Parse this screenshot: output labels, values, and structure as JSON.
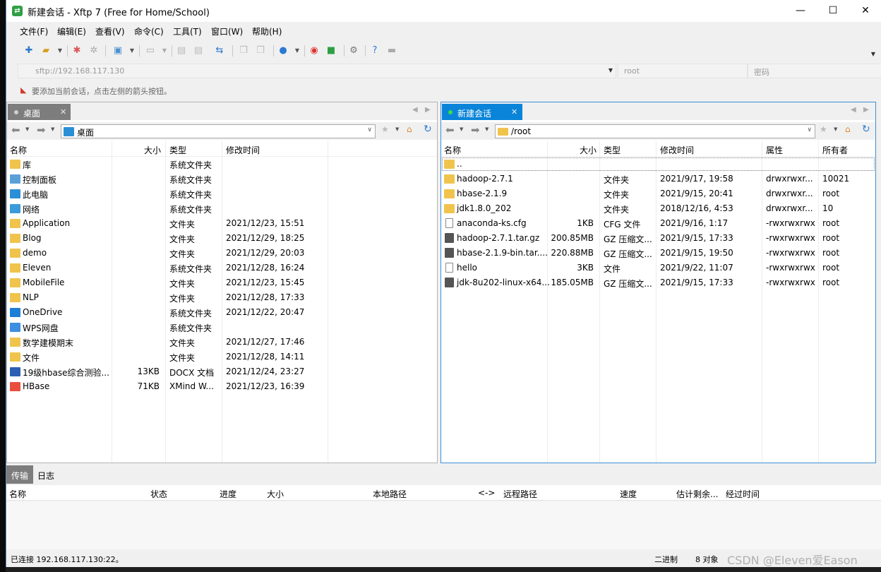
{
  "window": {
    "title": "新建会话 - Xftp 7 (Free for Home/School)",
    "minimize": "—",
    "maximize": "☐",
    "close": "✕"
  },
  "menu": [
    "文件(F)",
    "编辑(E)",
    "查看(V)",
    "命令(C)",
    "工具(T)",
    "窗口(W)",
    "帮助(H)"
  ],
  "address": {
    "url_placeholder": "sftp://192.168.117.130",
    "user_placeholder": "root",
    "password_placeholder": "密码"
  },
  "hint": "要添加当前会话，点击左侧的箭头按钮。",
  "left": {
    "tab": "桌面",
    "path": "桌面",
    "columns": [
      "名称",
      "大小",
      "类型",
      "修改时间"
    ],
    "rows": [
      {
        "name": "库",
        "size": "",
        "type": "系统文件夹",
        "mtime": "",
        "icon": "folder"
      },
      {
        "name": "控制面板",
        "size": "",
        "type": "系统文件夹",
        "mtime": "",
        "icon": "control-panel"
      },
      {
        "name": "此电脑",
        "size": "",
        "type": "系统文件夹",
        "mtime": "",
        "icon": "computer"
      },
      {
        "name": "网络",
        "size": "",
        "type": "系统文件夹",
        "mtime": "",
        "icon": "network"
      },
      {
        "name": "Application",
        "size": "",
        "type": "文件夹",
        "mtime": "2021/12/23, 15:51",
        "icon": "folder"
      },
      {
        "name": "Blog",
        "size": "",
        "type": "文件夹",
        "mtime": "2021/12/29, 18:25",
        "icon": "folder"
      },
      {
        "name": "demo",
        "size": "",
        "type": "文件夹",
        "mtime": "2021/12/29, 20:03",
        "icon": "folder"
      },
      {
        "name": "Eleven",
        "size": "",
        "type": "系统文件夹",
        "mtime": "2021/12/28, 16:24",
        "icon": "folder"
      },
      {
        "name": "MobileFile",
        "size": "",
        "type": "文件夹",
        "mtime": "2021/12/23, 15:45",
        "icon": "folder"
      },
      {
        "name": "NLP",
        "size": "",
        "type": "文件夹",
        "mtime": "2021/12/28, 17:33",
        "icon": "folder"
      },
      {
        "name": "OneDrive",
        "size": "",
        "type": "系统文件夹",
        "mtime": "2021/12/22, 20:47",
        "icon": "cloud"
      },
      {
        "name": "WPS网盘",
        "size": "",
        "type": "系统文件夹",
        "mtime": "",
        "icon": "wps-cloud"
      },
      {
        "name": "数学建模期末",
        "size": "",
        "type": "文件夹",
        "mtime": "2021/12/27, 17:46",
        "icon": "folder"
      },
      {
        "name": "文件",
        "size": "",
        "type": "文件夹",
        "mtime": "2021/12/28, 14:11",
        "icon": "folder"
      },
      {
        "name": "19级hbase综合测验...",
        "size": "13KB",
        "type": "DOCX 文档",
        "mtime": "2021/12/24, 23:27",
        "icon": "docx"
      },
      {
        "name": "HBase",
        "size": "71KB",
        "type": "XMind W...",
        "mtime": "2021/12/23, 16:39",
        "icon": "xmind"
      }
    ]
  },
  "right": {
    "tab": "新建会话",
    "path": "/root",
    "columns": [
      "名称",
      "大小",
      "类型",
      "修改时间",
      "属性",
      "所有者"
    ],
    "rows": [
      {
        "name": "..",
        "size": "",
        "type": "",
        "mtime": "",
        "attr": "",
        "owner": "",
        "icon": "folder"
      },
      {
        "name": "hadoop-2.7.1",
        "size": "",
        "type": "文件夹",
        "mtime": "2021/9/17, 19:58",
        "attr": "drwxrwxr...",
        "owner": "10021",
        "icon": "folder"
      },
      {
        "name": "hbase-2.1.9",
        "size": "",
        "type": "文件夹",
        "mtime": "2021/9/15, 20:41",
        "attr": "drwxrwxr...",
        "owner": "root",
        "icon": "folder"
      },
      {
        "name": "jdk1.8.0_202",
        "size": "",
        "type": "文件夹",
        "mtime": "2018/12/16, 4:53",
        "attr": "drwxrwxr...",
        "owner": "10",
        "icon": "folder"
      },
      {
        "name": "anaconda-ks.cfg",
        "size": "1KB",
        "type": "CFG 文件",
        "mtime": "2021/9/16, 1:17",
        "attr": "-rwxrwxrwx",
        "owner": "root",
        "icon": "file"
      },
      {
        "name": "hadoop-2.7.1.tar.gz",
        "size": "200.85MB",
        "type": "GZ 压缩文...",
        "mtime": "2021/9/15, 17:33",
        "attr": "-rwxrwxrwx",
        "owner": "root",
        "icon": "gz"
      },
      {
        "name": "hbase-2.1.9-bin.tar....",
        "size": "220.88MB",
        "type": "GZ 压缩文...",
        "mtime": "2021/9/15, 19:50",
        "attr": "-rwxrwxrwx",
        "owner": "root",
        "icon": "gz"
      },
      {
        "name": "hello",
        "size": "3KB",
        "type": "文件",
        "mtime": "2021/9/22, 11:07",
        "attr": "-rwxrwxrwx",
        "owner": "root",
        "icon": "file"
      },
      {
        "name": "jdk-8u202-linux-x64...",
        "size": "185.05MB",
        "type": "GZ 压缩文...",
        "mtime": "2021/9/15, 17:33",
        "attr": "-rwxrwxrwx",
        "owner": "root",
        "icon": "gz"
      }
    ]
  },
  "transfer": {
    "tabs": [
      "传输",
      "日志"
    ],
    "columns": [
      "名称",
      "状态",
      "进度",
      "大小",
      "本地路径",
      "<->",
      "远程路径",
      "速度",
      "估计剩余...",
      "经过时间"
    ]
  },
  "status": {
    "connection": "已连接 192.168.117.130:22。",
    "mode": "二进制",
    "count": "8 对象"
  },
  "watermark": "CSDN @Eleven爱Eason",
  "colors": {
    "accent": "#0a84d8",
    "folder": "#f0c44c",
    "tab_inactive": "#7d7d7d"
  }
}
